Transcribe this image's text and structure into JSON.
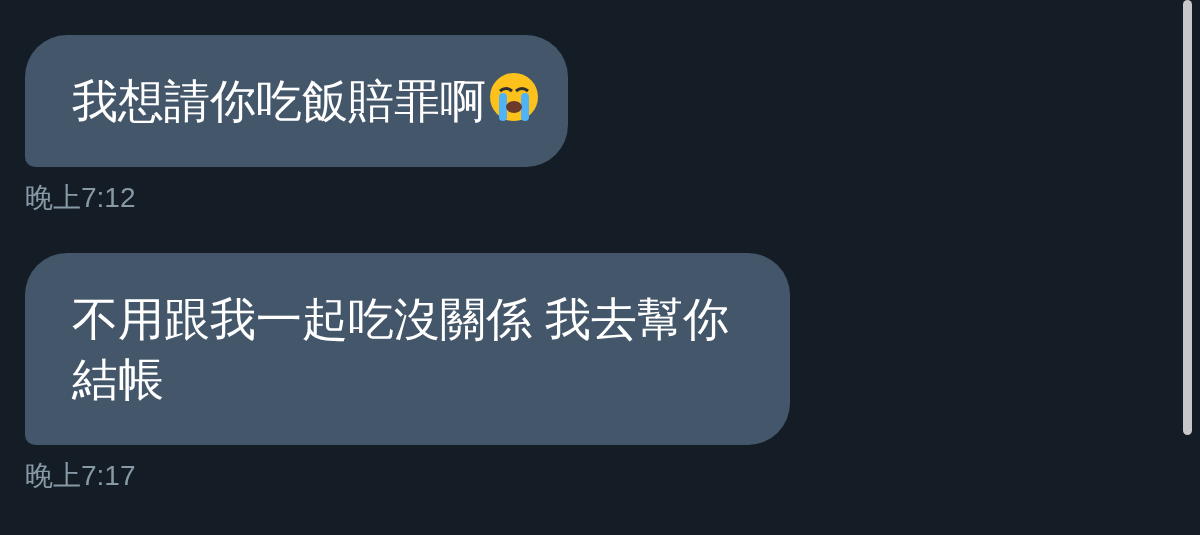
{
  "messages": [
    {
      "text": "我想請你吃飯賠罪啊",
      "emoji": true,
      "time": "晚上7:12"
    },
    {
      "text": "不用跟我一起吃沒關係 我去幫你結帳",
      "emoji": false,
      "time": "晚上7:17"
    }
  ]
}
